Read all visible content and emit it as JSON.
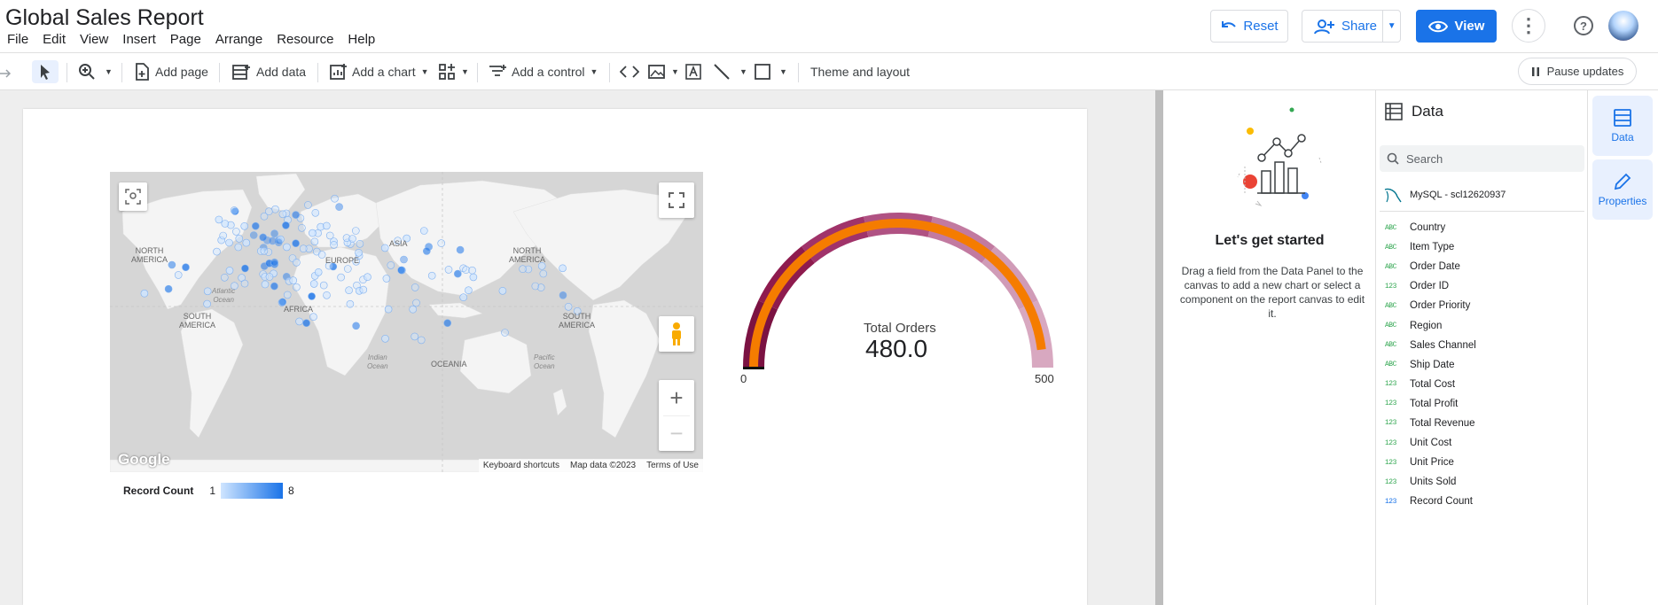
{
  "header": {
    "title": "Global Sales Report",
    "menu": [
      "File",
      "Edit",
      "View",
      "Insert",
      "Page",
      "Arrange",
      "Resource",
      "Help"
    ],
    "reset_label": "Reset",
    "share_label": "Share",
    "view_label": "View"
  },
  "toolbar": {
    "add_page": "Add page",
    "add_data": "Add data",
    "add_chart": "Add a chart",
    "add_control": "Add a control",
    "theme": "Theme and layout",
    "pause": "Pause updates"
  },
  "map": {
    "labels": {
      "north_america_l": "NORTH\nAMERICA",
      "north_america_r": "NORTH\nAMERICA",
      "south_america_l": "SOUTH\nAMERICA",
      "south_america_r": "SOUTH\nAMERICA",
      "europe": "EUROPE",
      "africa": "AFRICA",
      "asia": "ASIA",
      "oceania": "OCEANIA",
      "atlantic": "Atlantic\nOcean",
      "indian": "Indian\nOcean",
      "pacific": "Pacific\nOcean"
    },
    "google": "Google",
    "footer": [
      "Keyboard shortcuts",
      "Map data ©2023",
      "Terms of Use"
    ],
    "legend_label": "Record Count",
    "legend_min": "1",
    "legend_max": "8",
    "colors": {
      "low": "#cfe5ff",
      "high": "#1a73e8"
    }
  },
  "gauge": {
    "label": "Total Orders",
    "value_text": "480.0",
    "value": 480,
    "min_label": "0",
    "max_label": "500",
    "min": 0,
    "max": 500,
    "colors": {
      "bar": "#f57c00",
      "band_dark": "#8e1b4e",
      "band_light": "#d8a8c0"
    }
  },
  "empty_state": {
    "title": "Let's get started",
    "text": "Drag a field from the Data Panel to the canvas to add a new chart or select a component on the report canvas to edit it."
  },
  "data_panel": {
    "title": "Data",
    "search_placeholder": "Search",
    "source": "MySQL - scl12620937",
    "fields": [
      {
        "type": "ABC",
        "name": "Country"
      },
      {
        "type": "ABC",
        "name": "Item Type"
      },
      {
        "type": "ABC",
        "name": "Order Date"
      },
      {
        "type": "123",
        "name": "Order ID"
      },
      {
        "type": "ABC",
        "name": "Order Priority"
      },
      {
        "type": "ABC",
        "name": "Region"
      },
      {
        "type": "ABC",
        "name": "Sales Channel"
      },
      {
        "type": "ABC",
        "name": "Ship Date"
      },
      {
        "type": "123",
        "name": "Total Cost"
      },
      {
        "type": "123",
        "name": "Total Profit"
      },
      {
        "type": "123",
        "name": "Total Revenue"
      },
      {
        "type": "123",
        "name": "Unit Cost"
      },
      {
        "type": "123",
        "name": "Unit Price"
      },
      {
        "type": "123",
        "name": "Units Sold"
      },
      {
        "type": "123",
        "name": "Record Count"
      }
    ]
  },
  "rail": {
    "data_label": "Data",
    "properties_label": "Properties"
  }
}
